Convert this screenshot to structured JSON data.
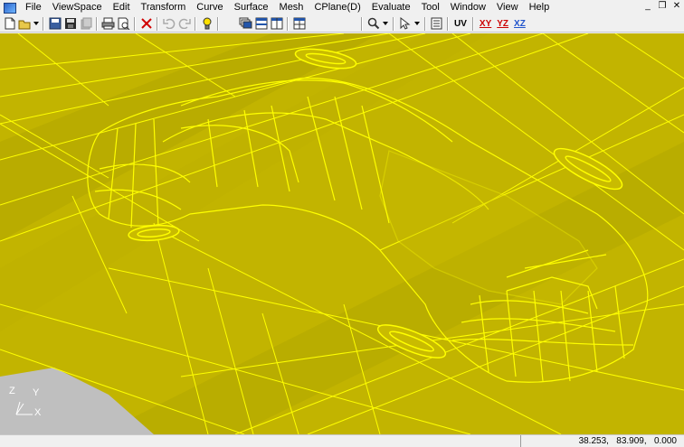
{
  "menu": {
    "items": [
      "File",
      "ViewSpace",
      "Edit",
      "Transform",
      "Curve",
      "Surface",
      "Mesh",
      "CPlane(D)",
      "Evaluate",
      "Tool",
      "Window",
      "View",
      "Help"
    ]
  },
  "window_controls": {
    "minimize": "_",
    "restore": "❐",
    "close": "✕"
  },
  "toolbar": {
    "uv_label": "UV",
    "xy_label": "XY",
    "yz_label": "YZ",
    "xz_label": "XZ"
  },
  "axis": {
    "z": "Z",
    "y": "Y",
    "x": "X"
  },
  "status": {
    "coordinates": "38.253,   83.909,   0.000"
  },
  "colors": {
    "viewport_bg": "#c2b400",
    "wire": "#ffff00",
    "plane_x": "#bba600"
  }
}
